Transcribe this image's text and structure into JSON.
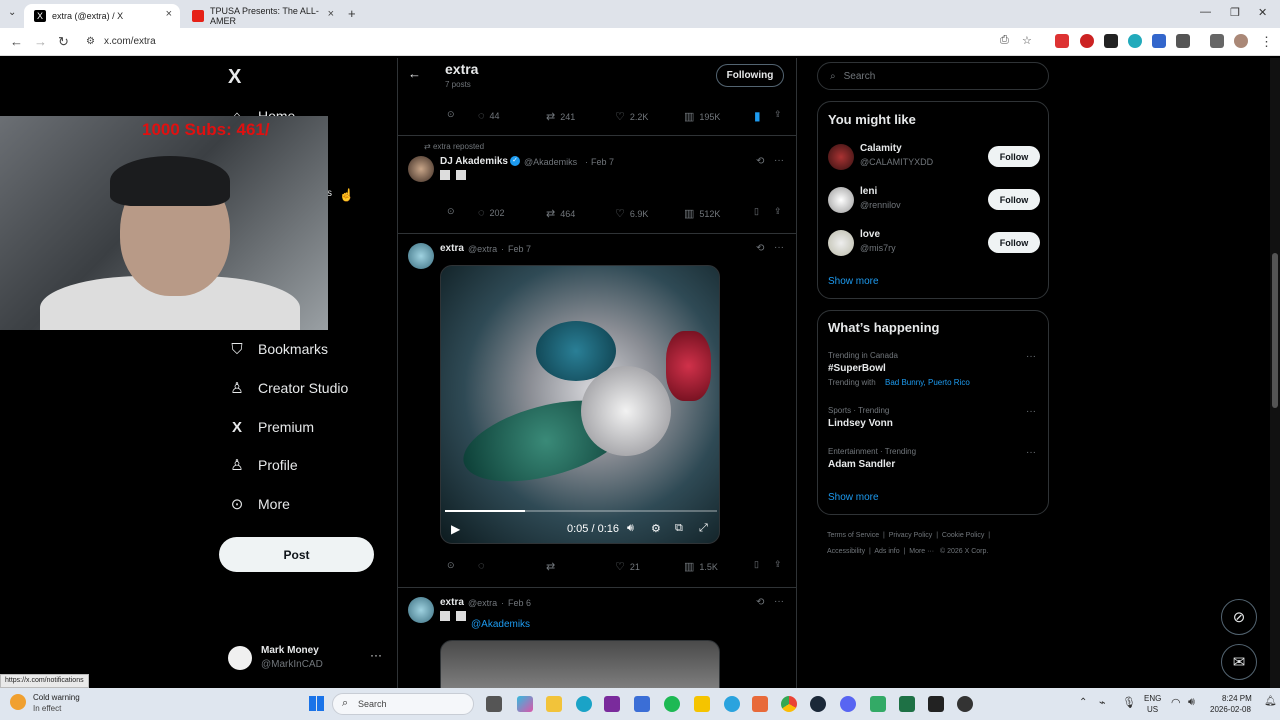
{
  "browser": {
    "tabs": [
      {
        "title": "extra (@extra) / X",
        "active": true
      },
      {
        "title": "TPUSA Presents: The ALL-AMER",
        "active": false
      }
    ],
    "new_tab": "+",
    "url": "x.com/extra",
    "status_url": "https://x.com/notifications"
  },
  "overlay": {
    "subs_text": "1000  Subs: 461/"
  },
  "leftnav": {
    "home": "Home",
    "partial": "s",
    "items": [
      "Bookmarks",
      "Creator Studio",
      "Premium",
      "Profile",
      "More"
    ],
    "post_button": "Post",
    "account_name": "Mark Money",
    "account_handle": "@MarkInCAD"
  },
  "profile_header": {
    "name": "extra",
    "post_count": "7 posts",
    "following_button": "Following"
  },
  "posts": [
    {
      "stats": {
        "replies": "44",
        "reposts": "241",
        "likes": "2.2K",
        "views": "195K"
      }
    },
    {
      "repost_label": "extra reposted",
      "author": "DJ Akademiks",
      "handle": "@Akademiks",
      "date": "Feb 7",
      "stats": {
        "replies": "202",
        "reposts": "464",
        "likes": "6.9K",
        "views": "512K"
      }
    },
    {
      "author": "extra",
      "handle": "@extra",
      "date": "Feb 7",
      "video_time": "0:05 / 0:16",
      "stats": {
        "replies": "",
        "reposts": "",
        "likes": "21",
        "views": "1.5K"
      }
    },
    {
      "author": "extra",
      "handle": "@extra",
      "date": "Feb 6",
      "mention": "@Akademiks"
    }
  ],
  "sidebar": {
    "search_placeholder": "Search",
    "you_might_like": {
      "title": "You might like",
      "users": [
        {
          "name": "Calamity",
          "handle": "@CALAMITYXDD"
        },
        {
          "name": "leni",
          "handle": "@rennilov"
        },
        {
          "name": "love",
          "handle": "@mis7ry"
        }
      ],
      "follow_label": "Follow",
      "show_more": "Show more"
    },
    "whats_happening": {
      "title": "What’s happening",
      "trends": [
        {
          "context": "Trending in Canada",
          "topic": "#SuperBowl",
          "extra_prefix": "Trending with",
          "extra": "Bad Bunny, Puerto Rico"
        },
        {
          "context": "Sports · Trending",
          "topic": "Lindsey Vonn"
        },
        {
          "context": "Entertainment · Trending",
          "topic": "Adam Sandler"
        }
      ],
      "show_more": "Show more"
    },
    "footer": [
      "Terms of Service",
      "Privacy Policy",
      "Cookie Policy",
      "Accessibility",
      "Ads info",
      "More ···",
      "© 2026 X Corp."
    ]
  },
  "taskbar": {
    "weather_title": "Cold warning",
    "weather_sub": "In effect",
    "search_label": "Search",
    "lang": "ENG",
    "region": "US",
    "time": "8:24 PM",
    "date": "2026-02-08"
  }
}
